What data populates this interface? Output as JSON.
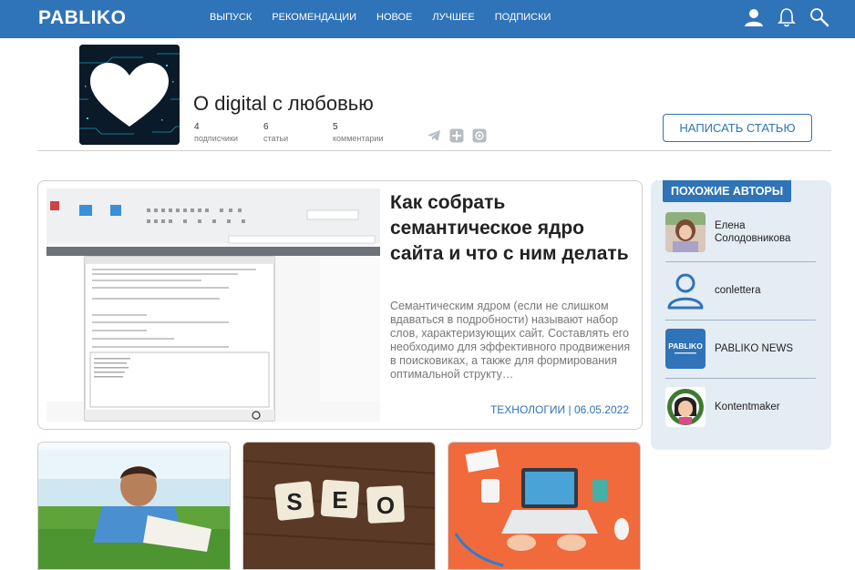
{
  "header": {
    "logo": "PABLIKO",
    "nav": [
      "ВЫПУСК",
      "РЕКОМЕНДАЦИИ",
      "НОВОЕ",
      "ЛУЧШЕЕ",
      "ПОДПИСКИ"
    ],
    "icons": [
      "user-icon",
      "bell-icon",
      "search-icon"
    ]
  },
  "profile": {
    "title": "О digital с любовью",
    "stats": [
      {
        "value": "4",
        "label": "подписчики"
      },
      {
        "value": "6",
        "label": "статьи"
      },
      {
        "value": "5",
        "label": "комментарии"
      }
    ],
    "write_button": "НАПИСАТЬ СТАТЬЮ"
  },
  "featured": {
    "title": "Как собрать семантическое ядро сайта и что с ним делать",
    "description": "Семантическим ядром (если не слишком вдаваться в подробности) называют набор слов, характеризующих сайт. Составлять его необходимо для эффективного продвижения в поисковиках, а также для формирования оптимальной структу…",
    "category": "ТЕХНОЛОГИИ",
    "date": "06.05.2022"
  },
  "similar": {
    "heading": "ПОХОЖИЕ АВТОРЫ",
    "authors": [
      {
        "name": "Елена Солодовникова"
      },
      {
        "name": "conlettera"
      },
      {
        "name": "PABLIKO NEWS"
      },
      {
        "name": "Kontentmaker"
      }
    ]
  },
  "cards": [
    {
      "image": "man-on-grass-photo"
    },
    {
      "image": "seo-tiles-photo"
    },
    {
      "image": "laptop-desk-photo"
    }
  ],
  "colors": {
    "brand": "#2f73b8",
    "panel": "#e4ecf4"
  }
}
